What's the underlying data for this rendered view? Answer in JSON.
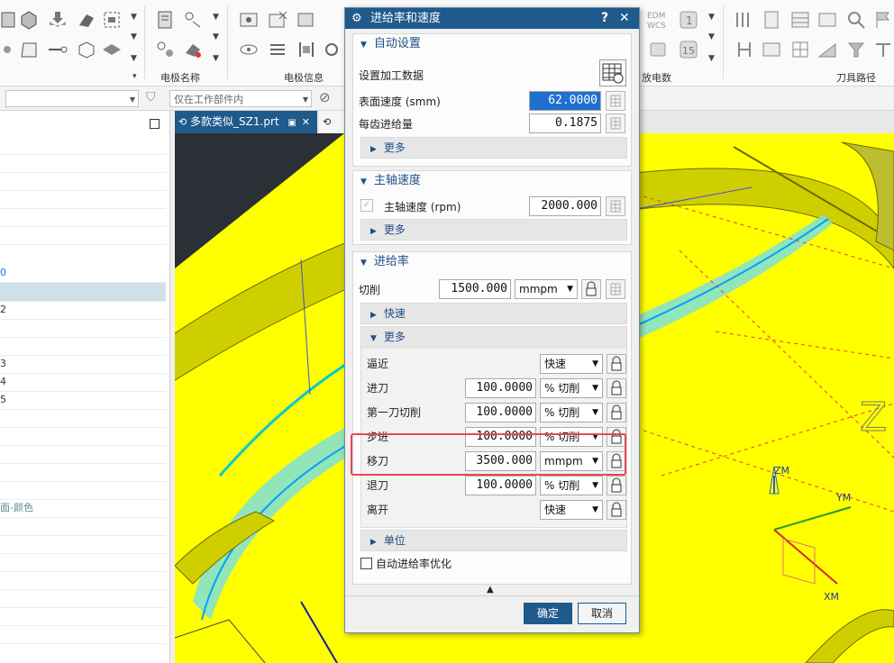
{
  "ribbon": {
    "groups": [
      {
        "label": "电极名称"
      },
      {
        "label": "电极信息"
      },
      {
        "label": "放电数"
      },
      {
        "label": "刀具路径"
      }
    ],
    "edm_text": "EDM",
    "wcs_text": "WCS",
    "icon_num_1": "1",
    "icon_num_15": "15"
  },
  "toolbar2": {
    "filter_placeholder": "仅在工作部件内"
  },
  "navigator": {
    "rows": [
      {
        "text": ""
      },
      {
        "text": ""
      },
      {
        "text": ""
      },
      {
        "text": ""
      },
      {
        "text": ""
      },
      {
        "text": ""
      },
      {
        "text": "0"
      },
      {
        "text": ""
      },
      {
        "text": "2"
      },
      {
        "text": ""
      },
      {
        "text": ""
      },
      {
        "text": "3"
      },
      {
        "text": "4"
      },
      {
        "text": "5"
      },
      {
        "text": ""
      },
      {
        "text": ""
      },
      {
        "text": ""
      },
      {
        "text": ""
      },
      {
        "text": ""
      },
      {
        "text": "面-颜色"
      }
    ]
  },
  "tabs": [
    {
      "label": "多款类似_SZ1.prt"
    },
    {
      "label": ""
    }
  ],
  "viewport": {
    "axis_zm": "ZM",
    "axis_ym": "YM",
    "axis_xm": "XM",
    "letter_z": "Z"
  },
  "dialog": {
    "title": "进给率和速度",
    "help": "?",
    "close": "✕",
    "auto": {
      "header": "自动设置",
      "set_data_label": "设置加工数据",
      "surface_speed_label": "表面速度 (smm)",
      "surface_speed_value": "62.0000",
      "feed_per_tooth_label": "每齿进给量",
      "feed_per_tooth_value": "0.1875",
      "more": "更多"
    },
    "spindle": {
      "header": "主轴速度",
      "speed_label": "主轴速度 (rpm)",
      "speed_value": "2000.000",
      "more": "更多"
    },
    "feed": {
      "header": "进给率",
      "cut_label": "切削",
      "cut_value": "1500.000",
      "cut_unit": "mmpm",
      "rapid": "快速",
      "more": "更多",
      "rows": [
        {
          "label": "逼近",
          "value": "",
          "unit": "快速"
        },
        {
          "label": "进刀",
          "value": "100.0000",
          "unit": "% 切削"
        },
        {
          "label": "第一刀切削",
          "value": "100.0000",
          "unit": "% 切削"
        },
        {
          "label": "步进",
          "value": "100.0000",
          "unit": "% 切削"
        },
        {
          "label": "移刀",
          "value": "3500.000",
          "unit": "mmpm"
        },
        {
          "label": "退刀",
          "value": "100.0000",
          "unit": "% 切削"
        },
        {
          "label": "离开",
          "value": "",
          "unit": "快速"
        }
      ],
      "units": "单位",
      "auto_optimize": "自动进给率优化"
    },
    "ok": "确定",
    "cancel": "取消"
  },
  "colors": {
    "viewport_bg": "#ffff00",
    "title_bar": "#1f5a8c",
    "highlight": "#e8474e",
    "ok_button": "#1f5a8c"
  }
}
